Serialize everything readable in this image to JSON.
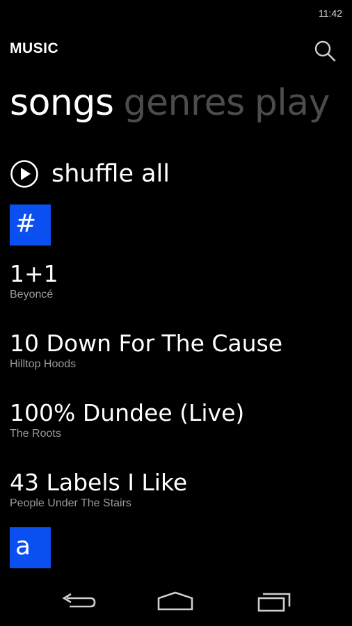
{
  "status_bar": {
    "time": "11:42"
  },
  "header": {
    "app_title": "MUSIC"
  },
  "pivot": {
    "items": [
      {
        "label": "songs",
        "active": true
      },
      {
        "label": "genres",
        "active": false
      },
      {
        "label": "play",
        "active": false
      }
    ]
  },
  "shuffle": {
    "label": "shuffle all"
  },
  "groups": [
    {
      "letter": "#"
    },
    {
      "letter": "a"
    }
  ],
  "songs": [
    {
      "title": "1+1",
      "artist": "Beyoncé"
    },
    {
      "title": "10 Down For The Cause",
      "artist": "Hilltop Hoods"
    },
    {
      "title": "100% Dundee (Live)",
      "artist": "The Roots"
    },
    {
      "title": "43 Labels I Like",
      "artist": "People Under The Stairs"
    }
  ],
  "icons": {
    "search": "search-icon",
    "shuffle": "play-circle-icon",
    "back": "back-arrow-icon",
    "home": "home-icon",
    "recents": "recent-apps-icon"
  },
  "colors": {
    "accent": "#0a50f0",
    "background": "#000000",
    "secondary_text": "#9a9a9a",
    "inactive_pivot": "#4c4c4c"
  }
}
